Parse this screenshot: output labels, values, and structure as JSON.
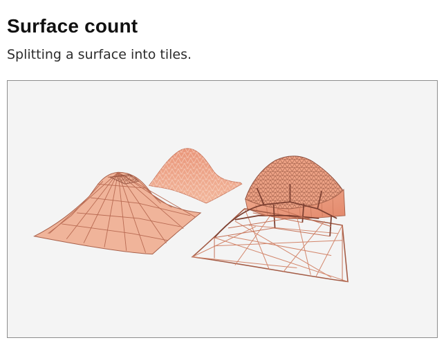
{
  "header": {
    "title": "Surface count",
    "subtitle": "Splitting a surface into tiles."
  },
  "viewport": {
    "background": "#f4f4f4",
    "model_color": "#e8a083",
    "model_edge_color": "#8a4b3a"
  }
}
